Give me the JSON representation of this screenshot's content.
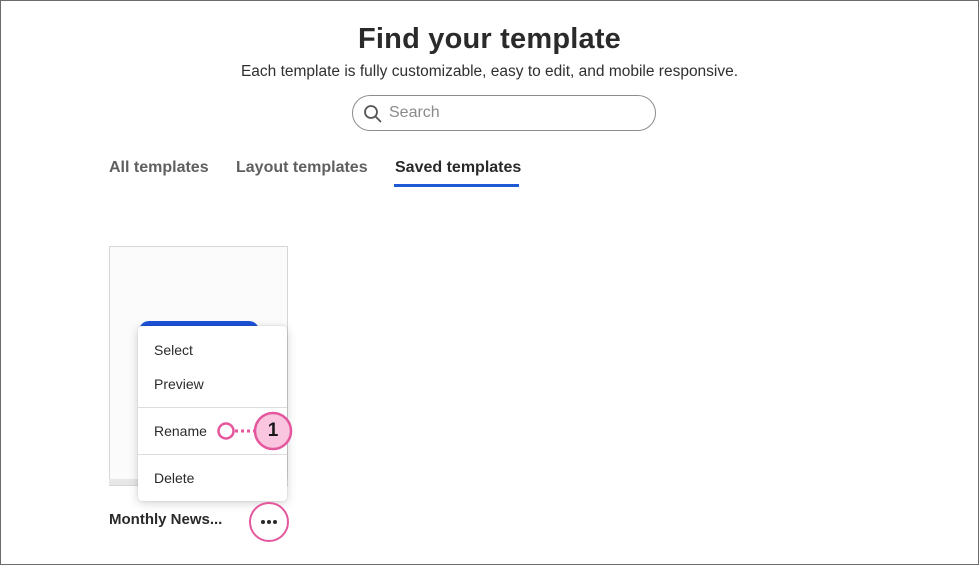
{
  "header": {
    "title": "Find your template",
    "subtitle": "Each template is fully customizable, easy to edit, and mobile responsive."
  },
  "search": {
    "placeholder": "Search",
    "icon": "search-icon"
  },
  "tabs": [
    {
      "label": "All templates",
      "active": false
    },
    {
      "label": "Layout templates",
      "active": false
    },
    {
      "label": "Saved templates",
      "active": true
    }
  ],
  "template_card": {
    "title": "Monthly News...",
    "more_icon": "more-horizontal-icon"
  },
  "context_menu": {
    "items": [
      {
        "label": "Select"
      },
      {
        "label": "Preview"
      },
      {
        "label": "Rename"
      },
      {
        "label": "Delete"
      }
    ]
  },
  "annotation": {
    "callout_number": "1"
  },
  "colors": {
    "accent_blue": "#1f5ad6",
    "callout_pink": "#e5579d",
    "callout_fill": "#f9c5df"
  }
}
